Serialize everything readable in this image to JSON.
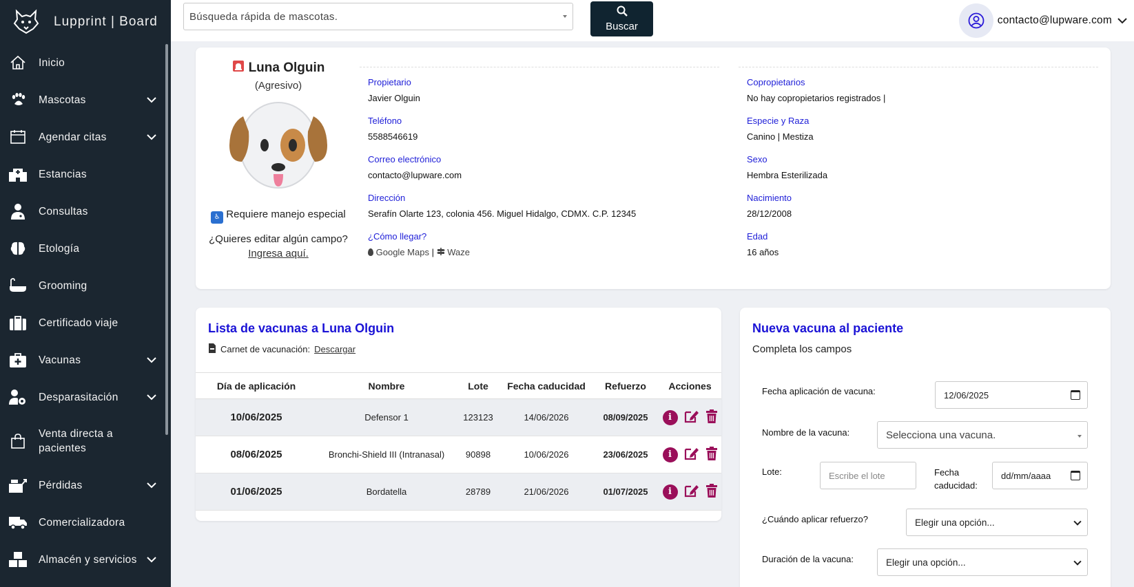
{
  "brand": {
    "name": "Lupprint | Board"
  },
  "sidebar": {
    "items": [
      {
        "label": "Inicio",
        "icon": "home-icon",
        "has_children": false
      },
      {
        "label": "Mascotas",
        "icon": "paw-icon",
        "has_children": true
      },
      {
        "label": "Agendar citas",
        "icon": "calendar-icon",
        "has_children": true
      },
      {
        "label": "Estancias",
        "icon": "hospital-icon",
        "has_children": false
      },
      {
        "label": "Consultas",
        "icon": "doctor-icon",
        "has_children": false
      },
      {
        "label": "Etología",
        "icon": "brain-icon",
        "has_children": false
      },
      {
        "label": "Grooming",
        "icon": "bath-icon",
        "has_children": false
      },
      {
        "label": "Certificado viaje",
        "icon": "suitcase-icon",
        "has_children": false
      },
      {
        "label": "Vacunas",
        "icon": "medkit-icon",
        "has_children": true
      },
      {
        "label": "Desparasitación",
        "icon": "user-gear-icon",
        "has_children": true
      },
      {
        "label": "Venta directa a pacientes",
        "icon": "shopping-bag-icon",
        "has_children": false
      },
      {
        "label": "Pérdidas",
        "icon": "cash-register-icon",
        "has_children": true
      },
      {
        "label": "Comercializadora",
        "icon": "truck-icon",
        "has_children": false
      },
      {
        "label": "Almacén y servicios",
        "icon": "boxes-icon",
        "has_children": true
      }
    ]
  },
  "topbar": {
    "search_placeholder": "Búsqueda rápida de mascotas.",
    "search_button": "Buscar",
    "user_email": "contacto@lupware.com"
  },
  "pet": {
    "name": "Luna Olguin",
    "temperament": "(Agresivo)",
    "special": "Requiere manejo especial",
    "edit_prefix": "¿Quieres editar algún campo?",
    "edit_link": "Ingresa aquí.",
    "left_fields": [
      {
        "label": "Propietario",
        "value": "Javier Olguin"
      },
      {
        "label": "Teléfono",
        "value": "5588546619"
      },
      {
        "label": "Correo electrónico",
        "value": "contacto@lupware.com"
      },
      {
        "label": "Dirección",
        "value": "Serafín Olarte 123, colonia 456. Miguel Hidalgo, CDMX. C.P. 12345"
      }
    ],
    "how_to_label": "¿Cómo llegar?",
    "maps_label": "Google Maps",
    "waze_label": "Waze",
    "right_fields": [
      {
        "label": "Copropietarios",
        "value": "No hay copropietarios registrados |"
      },
      {
        "label": "Especie y Raza",
        "value": "Canino | Mestiza"
      },
      {
        "label": "Sexo",
        "value": "Hembra Esterilizada"
      },
      {
        "label": "Nacimiento",
        "value": "28/12/2008"
      },
      {
        "label": "Edad",
        "value": "16 años"
      }
    ]
  },
  "vaccines": {
    "title": "Lista de vacunas a Luna Olguin",
    "card_label": "Carnet de vacunación:",
    "download_link": "Descargar",
    "columns": [
      "Día de aplicación",
      "Nombre",
      "Lote",
      "Fecha caducidad",
      "Refuerzo",
      "Acciones"
    ],
    "rows": [
      {
        "date": "10/06/2025",
        "name": "Defensor 1",
        "lot": "123123",
        "expiry": "14/06/2026",
        "booster": "08/09/2025"
      },
      {
        "date": "08/06/2025",
        "name": "Bronchi-Shield III (Intranasal)",
        "lot": "90898",
        "expiry": "10/06/2026",
        "booster": "23/06/2025"
      },
      {
        "date": "01/06/2025",
        "name": "Bordatella",
        "lot": "28789",
        "expiry": "21/06/2026",
        "booster": "01/07/2025"
      }
    ]
  },
  "new_vaccine": {
    "title": "Nueva vacuna al paciente",
    "subtitle": "Completa los campos",
    "apply_date_label": "Fecha aplicación de vacuna:",
    "apply_date_value": "12/06/2025",
    "name_label": "Nombre de la vacuna:",
    "name_placeholder": "Selecciona una vacuna.",
    "lot_label": "Lote:",
    "lot_placeholder": "Escribe el lote",
    "expiry_label": "Fecha caducidad:",
    "expiry_placeholder": "dd/mm/aaaa",
    "booster_label": "¿Cuándo aplicar refuerzo?",
    "booster_value": "Elegir una opción...",
    "duration_label": "Duración de la vacuna:",
    "duration_value": "Elegir una opción..."
  },
  "colors": {
    "sidebar_bg": "#1b2630",
    "accent_blue": "#1a12d6",
    "action_magenta": "#9a0f5a",
    "search_button": "#102430"
  }
}
